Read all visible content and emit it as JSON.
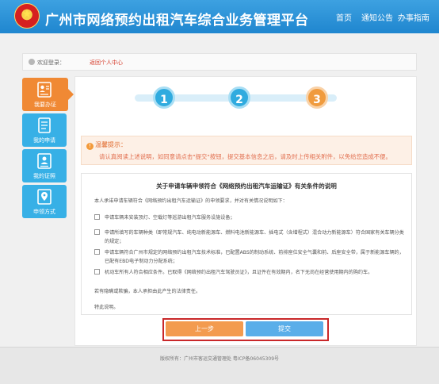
{
  "header": {
    "title": "广州市网络预约出租汽车综合业务管理平台",
    "nav": [
      "首页",
      "通知公告",
      "办事指南"
    ]
  },
  "breadcrumb": {
    "welcome": "欢迎登录：",
    "user": "",
    "back": "返回个人中心"
  },
  "sidebar": {
    "items": [
      {
        "label": "我要办证",
        "icon": "user-card-icon",
        "active": true
      },
      {
        "label": "我的申请",
        "icon": "document-icon",
        "active": false
      },
      {
        "label": "我的证照",
        "icon": "id-card-icon",
        "active": false
      },
      {
        "label": "申领方式",
        "icon": "location-pin-icon",
        "active": false
      }
    ]
  },
  "steps": [
    "1",
    "2",
    "3"
  ],
  "warning": {
    "title": "温馨提示：",
    "text": "请认真阅读上述说明，如同意请点击\"提交\"按钮，提交基本信息之后，请及时上传相关附件，以免给您造成不便。"
  },
  "doc": {
    "title": "关于申请车辆申领符合《网络预约出租汽车运输证》有关条件的说明",
    "intro": "本人承诺申请车辆符合《网络预约出租汽车运输证》的申领要求，并对有关情况说明如下：",
    "items": [
      "申请车辆未安装顶灯、空载灯等巡游出租汽车服务设施设备；",
      "申请所填写的车辆种类（即常规汽车、纯电动新能源车、燃料电池新能源车、插电式（含增程式）混合动力新能源车）符合国家有关车辆分类的规定；",
      "申请车辆符合广州市规定的网络预约出租汽车技术标准，已配置ABS的制动系统、前排座位安全气囊和前、后座安全带，属于新能源车辆的，已配有EBD电子制动力分配系统；",
      "机动车所有人符合相应条件。已取得《网络预约出租汽车驾驶员证》，且证件在有效期内，名下无尚在经营使用期内的购约车。"
    ],
    "closing1": "若有隐瞒或欺骗，本人承担由此产生的法律责任。",
    "closing2": "特此说明。"
  },
  "buttons": {
    "prev": "上一步",
    "submit": "提交"
  },
  "footer": {
    "text": "版权所有：广州市客运交通管理处  粤ICP备06045309号"
  },
  "colors": {
    "header": "#2791d6",
    "active_tab": "#f08934",
    "tab": "#37b0e6",
    "step_done": "#30abdf",
    "step_current": "#f09b3e",
    "highlight_frame": "#c9282a"
  }
}
